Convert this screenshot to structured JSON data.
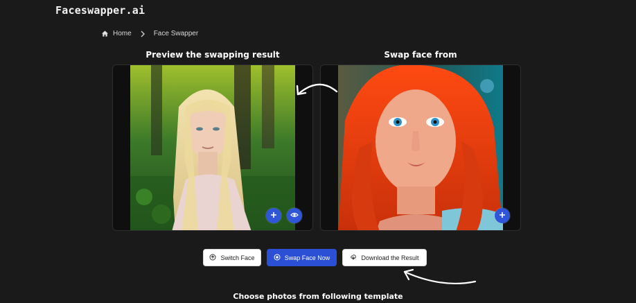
{
  "app": {
    "logo_text": "Faceswapper.ai"
  },
  "breadcrumb": {
    "home_label": "Home",
    "current_label": "Face Swapper"
  },
  "preview_panel": {
    "title": "Preview the swapping result"
  },
  "source_panel": {
    "title": "Swap face from"
  },
  "actions": {
    "switch_label": "Switch Face",
    "swap_label": "Swap Face Now",
    "download_label": "Download the Result"
  },
  "templates": {
    "title": "Choose photos from following template"
  },
  "colors": {
    "background": "#1a1a1a",
    "panel": "#0f0f10",
    "accent": "#2b50d6",
    "fab": "#2f56d9"
  },
  "icons": {
    "home": "home-icon",
    "chevron": "chevron-right-icon",
    "add": "plus-icon",
    "preview": "eye-icon",
    "switch": "switch-icon",
    "swap": "swap-icon",
    "download": "download-icon"
  }
}
